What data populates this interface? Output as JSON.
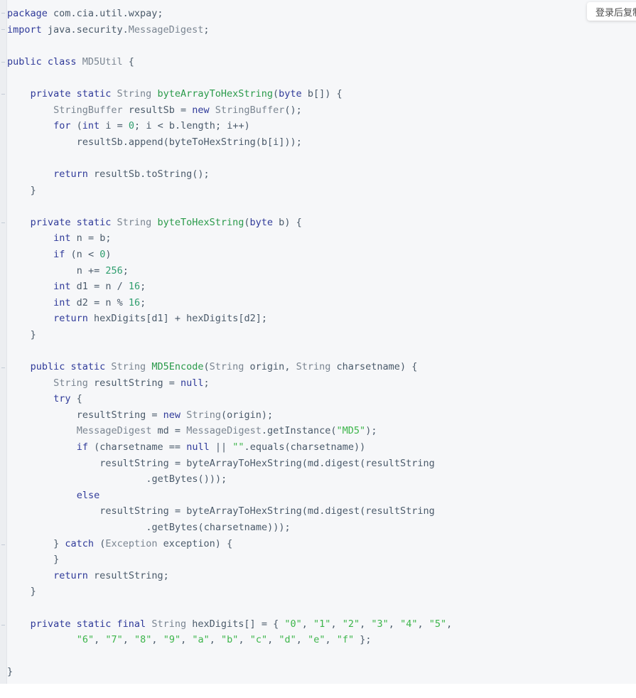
{
  "copy_button": {
    "label": "登录后复制",
    "name": "copy-code-button"
  },
  "code_block": {
    "language": "java",
    "background": "#f6f7f9",
    "colors": {
      "keyword": "#2f3a99",
      "type": "#7a8591",
      "function": "#2a9a4a",
      "string": "#3cb54a",
      "number": "#2f9e6e",
      "plain": "#4a5a6a"
    },
    "lines": [
      "package com.cia.util.wxpay;",
      "import java.security.MessageDigest;",
      "",
      "public class MD5Util {",
      "",
      "    private static String byteArrayToHexString(byte b[]) {",
      "        StringBuffer resultSb = new StringBuffer();",
      "        for (int i = 0; i < b.length; i++)",
      "            resultSb.append(byteToHexString(b[i]));",
      "",
      "        return resultSb.toString();",
      "    }",
      "",
      "    private static String byteToHexString(byte b) {",
      "        int n = b;",
      "        if (n < 0)",
      "            n += 256;",
      "        int d1 = n / 16;",
      "        int d2 = n % 16;",
      "        return hexDigits[d1] + hexDigits[d2];",
      "    }",
      "",
      "    public static String MD5Encode(String origin, String charsetname) {",
      "        String resultString = null;",
      "        try {",
      "            resultString = new String(origin);",
      "            MessageDigest md = MessageDigest.getInstance(\"MD5\");",
      "            if (charsetname == null || \"\".equals(charsetname))",
      "                resultString = byteArrayToHexString(md.digest(resultString",
      "                        .getBytes()));",
      "            else",
      "                resultString = byteArrayToHexString(md.digest(resultString",
      "                        .getBytes(charsetname)));",
      "        } catch (Exception exception) {",
      "        }",
      "        return resultString;",
      "    }",
      "",
      "    private static final String hexDigits[] = { \"0\", \"1\", \"2\", \"3\", \"4\", \"5\",",
      "            \"6\", \"7\", \"8\", \"9\", \"a\", \"b\", \"c\", \"d\", \"e\", \"f\" };",
      "",
      "}"
    ]
  }
}
